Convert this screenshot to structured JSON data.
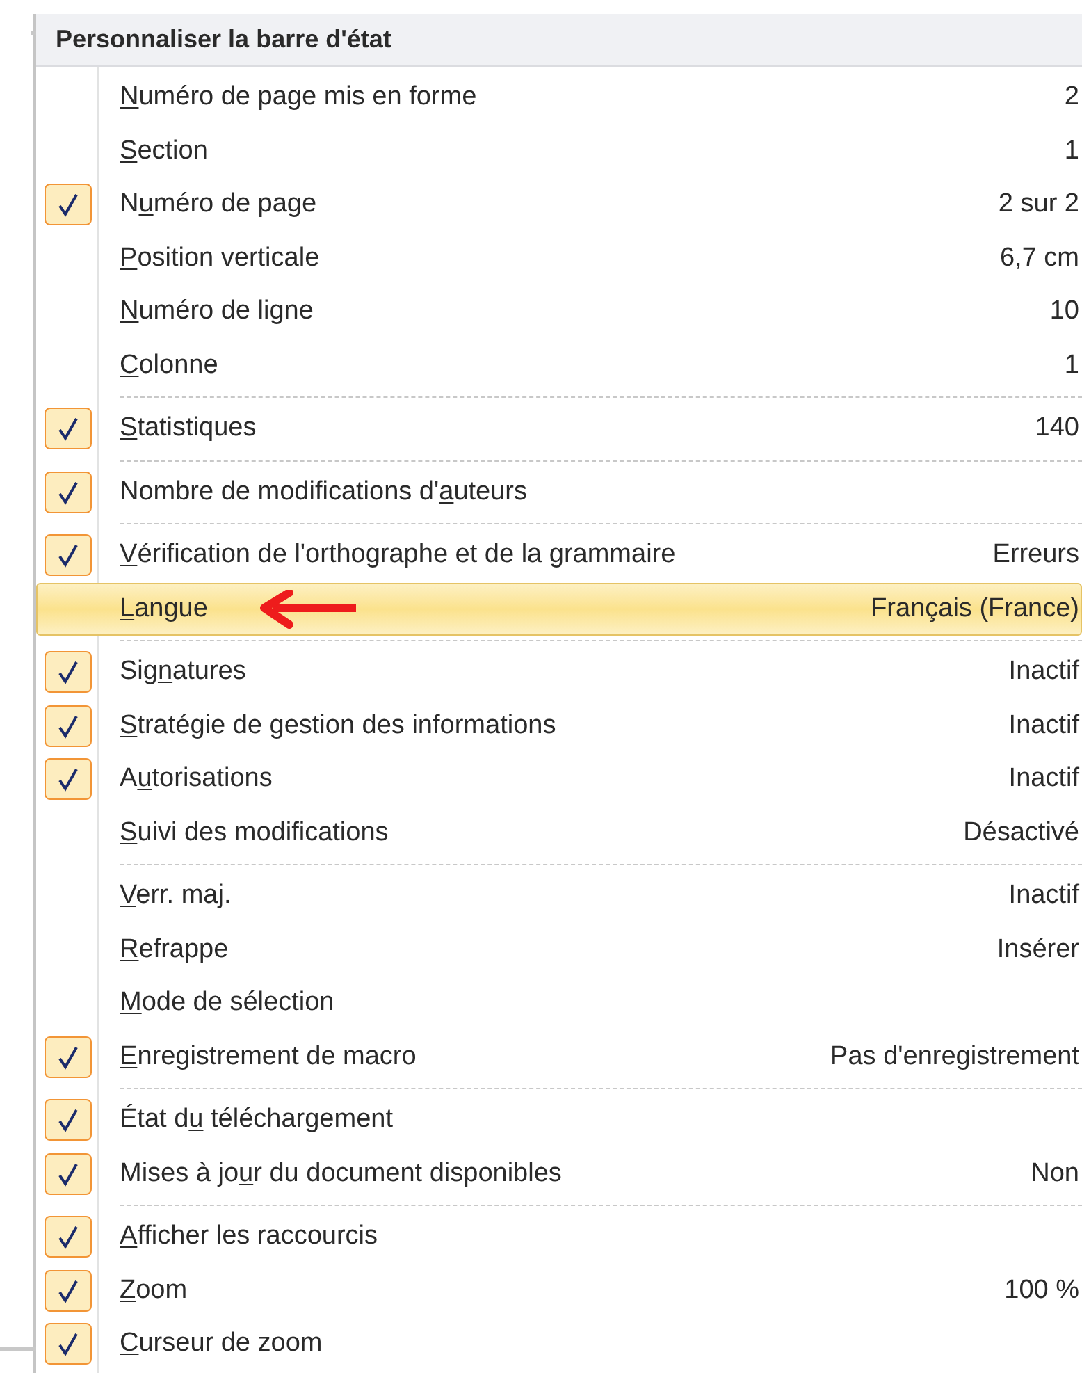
{
  "menu": {
    "title": "Personnaliser la barre d'état",
    "items": [
      {
        "key": "N",
        "post": "uméro de page mis en forme",
        "value": "2",
        "checked": false,
        "selected": false,
        "separator_above": false
      },
      {
        "key": "S",
        "post": "ection",
        "value": "1",
        "checked": false,
        "selected": false,
        "separator_above": false
      },
      {
        "pre": "N",
        "key": "u",
        "post": "méro de page",
        "value": "2 sur 2",
        "checked": true,
        "selected": false,
        "separator_above": false
      },
      {
        "key": "P",
        "post": "osition verticale",
        "value": "6,7 cm",
        "checked": false,
        "selected": false,
        "separator_above": false
      },
      {
        "key": "N",
        "post": "uméro de ligne",
        "value": "10",
        "checked": false,
        "selected": false,
        "separator_above": false
      },
      {
        "key": "C",
        "post": "olonne",
        "value": "1",
        "checked": false,
        "selected": false,
        "separator_above": false
      },
      {
        "key": "S",
        "post": "tatistiques",
        "value": "140",
        "checked": true,
        "selected": false,
        "separator_above": true
      },
      {
        "pre": "Nombre de modifications d'",
        "key": "a",
        "post": "uteurs",
        "checked": true,
        "selected": false,
        "separator_above": true
      },
      {
        "key": "V",
        "post": "érification de l'orthographe et de la grammaire",
        "value": "Erreurs",
        "checked": true,
        "selected": false,
        "separator_above": true
      },
      {
        "key": "L",
        "post": "angue",
        "value": "Français (France)",
        "checked": false,
        "selected": true,
        "separator_above": false
      },
      {
        "pre": "Sig",
        "key": "n",
        "post": "atures",
        "value": "Inactif",
        "checked": true,
        "selected": false,
        "separator_above": true
      },
      {
        "key": "S",
        "post": "tratégie de gestion des informations",
        "value": "Inactif",
        "checked": true,
        "selected": false,
        "separator_above": false
      },
      {
        "pre": "A",
        "key": "u",
        "post": "torisations",
        "value": "Inactif",
        "checked": true,
        "selected": false,
        "separator_above": false
      },
      {
        "key": "S",
        "post": "uivi des modifications",
        "value": "Désactivé",
        "checked": false,
        "selected": false,
        "separator_above": false
      },
      {
        "key": "V",
        "post": "err. maj.",
        "value": "Inactif",
        "checked": false,
        "selected": false,
        "separator_above": true
      },
      {
        "key": "R",
        "post": "efrappe",
        "value": "Insérer",
        "checked": false,
        "selected": false,
        "separator_above": false
      },
      {
        "key": "M",
        "post": "ode de sélection",
        "checked": false,
        "selected": false,
        "separator_above": false
      },
      {
        "key": "E",
        "post": "nregistrement de macro",
        "value": "Pas d'enregistrement",
        "checked": true,
        "selected": false,
        "separator_above": false
      },
      {
        "pre": "État d",
        "key": "u",
        "post": " téléchargement",
        "checked": true,
        "selected": false,
        "separator_above": true
      },
      {
        "pre": "Mises à jo",
        "key": "u",
        "post": "r du document disponibles",
        "value": "Non",
        "checked": true,
        "selected": false,
        "separator_above": false
      },
      {
        "key": "A",
        "post": "fficher les raccourcis",
        "checked": true,
        "selected": false,
        "separator_above": true
      },
      {
        "key": "Z",
        "post": "oom",
        "value": "100 %",
        "checked": true,
        "selected": false,
        "separator_above": false
      },
      {
        "key": "C",
        "post": "urseur de zoom",
        "checked": true,
        "selected": false,
        "separator_above": false
      }
    ]
  }
}
